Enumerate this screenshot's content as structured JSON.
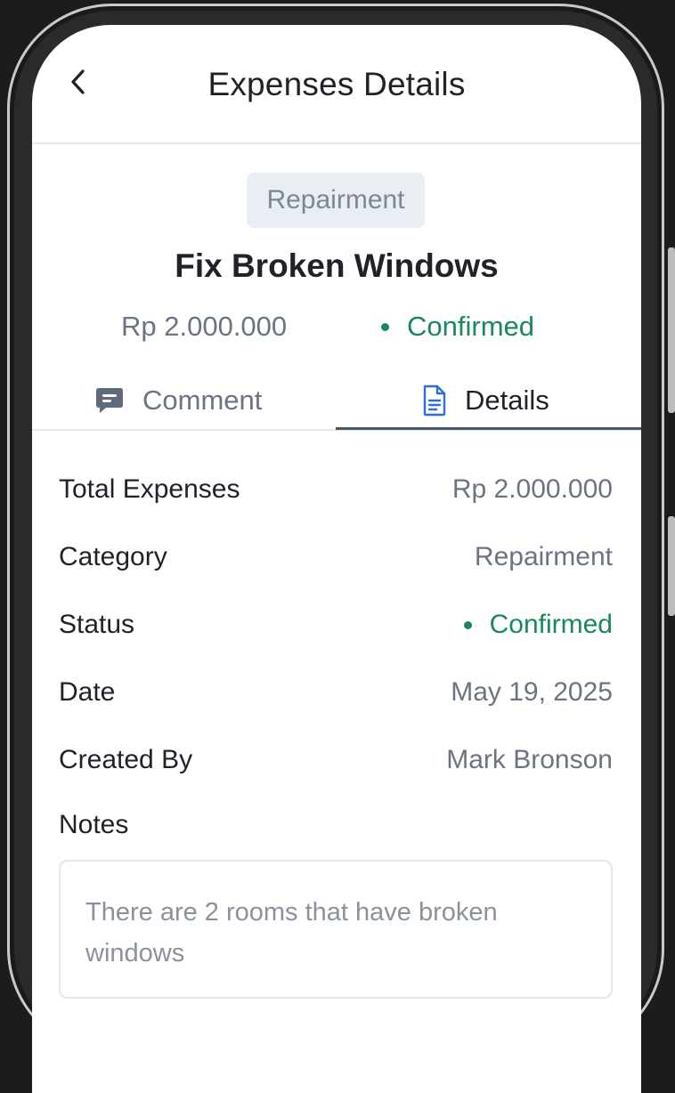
{
  "header": {
    "title": "Expenses Details"
  },
  "expense": {
    "category": "Repairment",
    "title": "Fix Broken Windows",
    "amount": "Rp 2.000.000",
    "status": "Confirmed"
  },
  "tabs": [
    {
      "label": "Comment",
      "icon": "comment-icon",
      "active": false
    },
    {
      "label": "Details",
      "icon": "document-icon",
      "active": true
    }
  ],
  "details": [
    {
      "label": "Total Expenses",
      "value": "Rp 2.000.000"
    },
    {
      "label": "Category",
      "value": "Repairment"
    },
    {
      "label": "Status",
      "value": "Confirmed"
    },
    {
      "label": "Date",
      "value": "May 19, 2025"
    },
    {
      "label": "Created By",
      "value": "Mark Bronson"
    }
  ],
  "notes": {
    "label": "Notes",
    "text": "There are 2 rooms that have broken windows"
  },
  "colors": {
    "status_green": "#178a58",
    "badge_bg": "#e8eef3",
    "text_primary": "#1f2228",
    "text_secondary": "#6a7482",
    "active_tab_underline": "#4b5563",
    "comment_icon": "#5f6b7a",
    "document_icon": "#2f6fd6"
  }
}
